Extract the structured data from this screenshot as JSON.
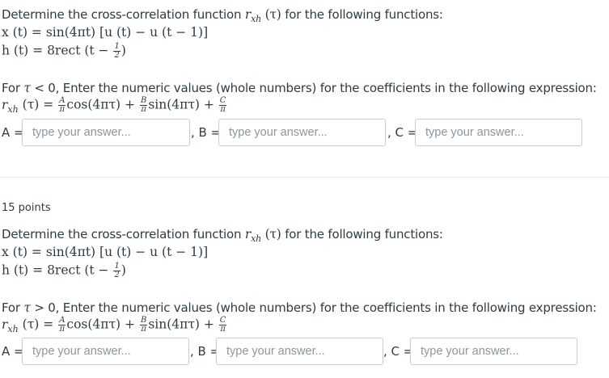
{
  "q1": {
    "intro": "Determine the cross-correlation function",
    "intro_tail": "for the following functions:",
    "rxh": "r",
    "rxh_sub": "xh",
    "tau_arg": "(τ)",
    "x_eq": "x (t) = sin(4πt) [u (t) − u (t − 1)]",
    "h_eq_pre": "h (t) = 8rect (t −",
    "h_eq_post": ")",
    "half_num": "1",
    "half_den": "2",
    "cond_pre": "For",
    "cond_tau": "τ",
    "cond_post": "< 0, Enter the numeric values (whole numbers) for the coefficients in the following expression:",
    "expr_lhs": "(τ) =",
    "expr_cos": "cos(4πτ) +",
    "expr_sin": "sin(4πτ) +",
    "A": "A",
    "B": "B",
    "C": "C",
    "pi": "π",
    "label_A": "A =",
    "label_B": ", B =",
    "label_C": ", C =",
    "placeholder": "type your answer..."
  },
  "q2": {
    "points": "15 points",
    "intro": "Determine the cross-correlation function",
    "intro_tail": "for the following functions:",
    "rxh": "r",
    "rxh_sub": "xh",
    "tau_arg": "(τ)",
    "x_eq": "x (t) = sin(4πt) [u (t) − u (t − 1)]",
    "h_eq_pre": "h (t) = 8rect (t −",
    "h_eq_post": ")",
    "half_num": "1",
    "half_den": "2",
    "cond_pre": "For",
    "cond_tau": "τ",
    "cond_post": "> 0, Enter the numeric values (whole numbers) for the coefficients in the following expression:",
    "expr_lhs": "(τ) =",
    "expr_cos": "cos(4πτ) +",
    "expr_sin": "sin(4πτ) +",
    "A": "A",
    "B": "B",
    "C": "C",
    "pi": "π",
    "label_A": "A =",
    "label_B": ", B =",
    "label_C": ", C =",
    "placeholder": "type your answer..."
  }
}
